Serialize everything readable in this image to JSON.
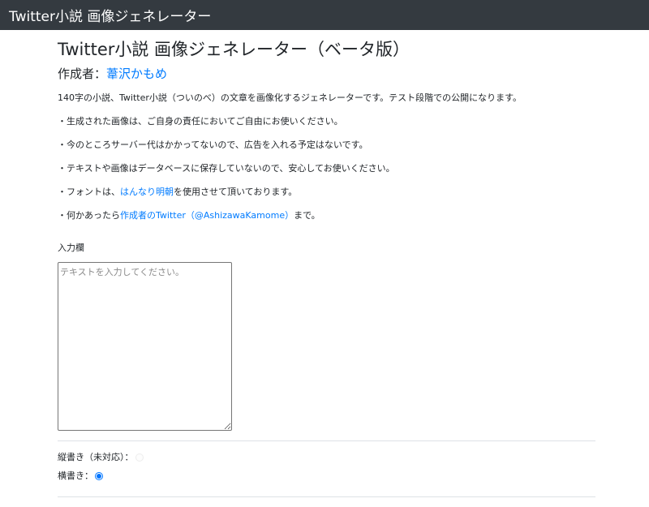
{
  "navbar": {
    "brand": "Twitter小説 画像ジェネレーター"
  },
  "page": {
    "title": "Twitter小説 画像ジェネレーター（ベータ版）",
    "author_prefix": "作成者：",
    "author_name": "葦沢かもめ"
  },
  "description": {
    "line1": "140字の小説、Twitter小説（ついのべ）の文章を画像化するジェネレーターです。テスト段階での公開になります。",
    "line2": "・生成された画像は、ご自身の責任においてご自由にお使いください。",
    "line3": "・今のところサーバー代はかかってないので、広告を入れる予定はないです。",
    "line4": "・テキストや画像はデータベースに保存していないので、安心してお使いください。",
    "line5_prefix": "・フォントは、",
    "line5_link": "はんなり明朝",
    "line5_suffix": "を使用させて頂いております。",
    "line6_prefix": "・何かあったら",
    "line6_link": "作成者のTwitter（@AshizawaKamome）",
    "line6_suffix": "まで。"
  },
  "form": {
    "input_label": "入力欄",
    "textarea_placeholder": "テキストを入力してください。",
    "textarea_value": "",
    "vertical_label": "縦書き（未対応）：",
    "vertical_disabled": true,
    "horizontal_label": "横書き：",
    "selected_orientation": "横書き"
  },
  "colors": {
    "navbar_bg": "#343a40",
    "link": "#007bff",
    "radio_checked": "#1a73e8"
  }
}
